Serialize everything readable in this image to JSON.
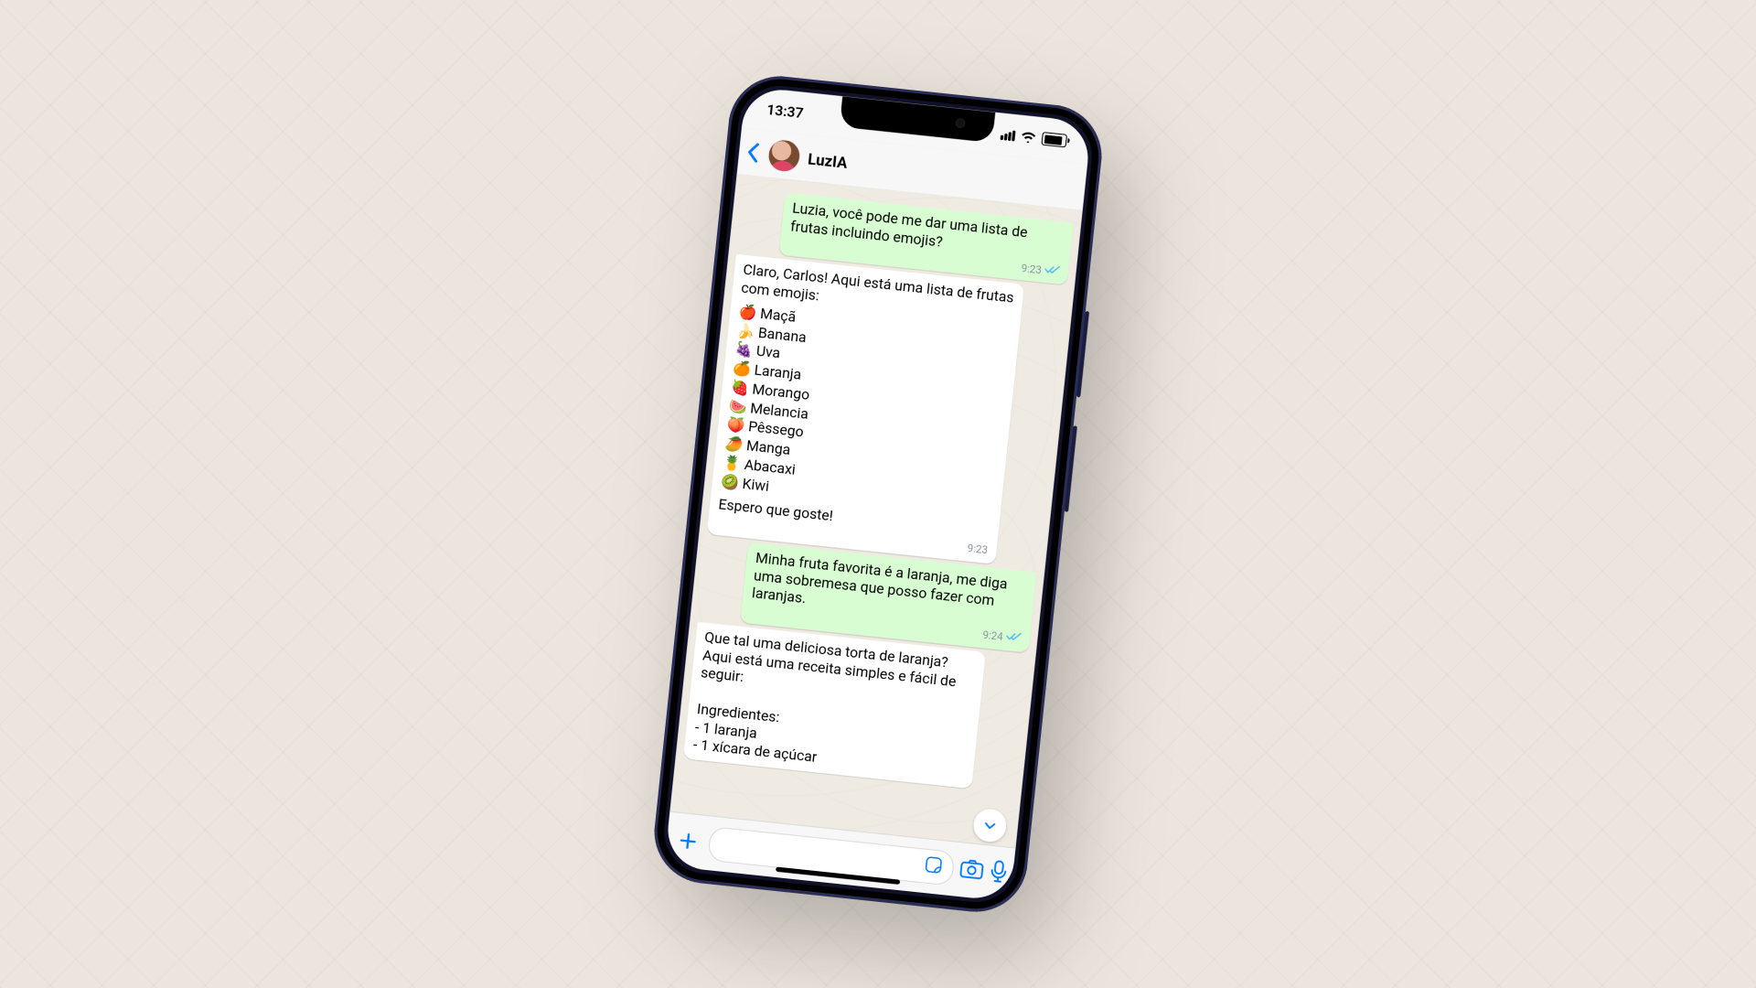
{
  "status": {
    "time": "13:37"
  },
  "header": {
    "contact_name": "LuzIA"
  },
  "messages": {
    "m1": {
      "text": "Luzia, você pode me dar uma lista de frutas incluindo emojis?",
      "time": "9:23"
    },
    "m2": {
      "intro": "Claro, Carlos! Aqui está uma lista de frutas com emojis:",
      "fruits": [
        "🍎 Maçã",
        "🍌 Banana",
        "🍇 Uva",
        "🍊 Laranja",
        "🍓 Morango",
        "🍉 Melancia",
        "🍑 Pêssego",
        "🥭 Manga",
        "🍍 Abacaxi",
        "🥝 Kiwi"
      ],
      "outro": "Espero que goste!",
      "time": "9:23"
    },
    "m3": {
      "text": "Minha fruta favorita é a laranja, me diga uma sobremesa que posso fazer com laranjas.",
      "time": "9:24"
    },
    "m4": {
      "text": "Que tal uma deliciosa torta de laranja? Aqui está uma receita simples e fácil de seguir:\n\nIngredientes:\n- 1 laranja\n- 1 xícara de açúcar"
    }
  },
  "inputbar": {
    "placeholder": ""
  }
}
